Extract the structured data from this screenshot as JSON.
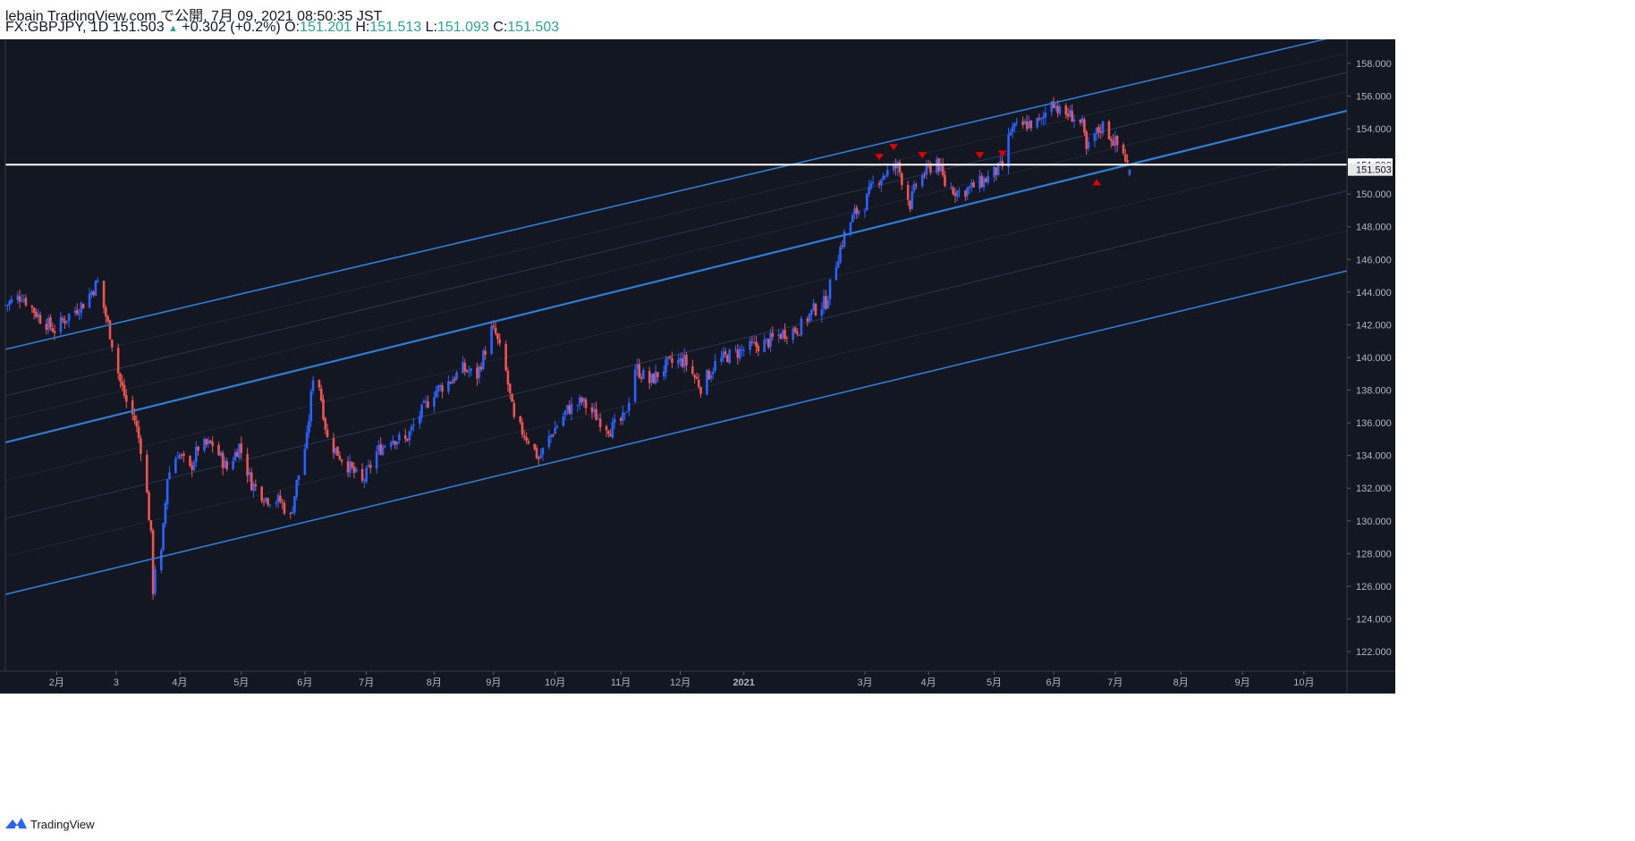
{
  "header": {
    "published_line": "lebain TradingView.com で公開, 7月 09, 2021 08:50:35 JST",
    "symbol": "FX:GBPJPY, 1D",
    "last": "151.503",
    "change": "+0.302 (+0.2%)",
    "o_label": "O:",
    "o_value": "151.201",
    "h_label": "H:",
    "h_value": "151.513",
    "l_label": "L:",
    "l_value": "151.093",
    "c_label": "C:",
    "c_value": "151.503"
  },
  "footer": {
    "brand": "TradingView"
  },
  "colors": {
    "background": "#131722",
    "up": "#2962ff",
    "down": "#ef5350",
    "channel": "#2e7dd7",
    "hline": "#ffffff",
    "marker": "#e00000",
    "text": "#b2b5be"
  },
  "price_labels": {
    "hline": "151.800",
    "last": "151.503"
  },
  "chart_data": {
    "type": "candlestick",
    "title": "FX:GBPJPY, 1D",
    "ylim": [
      120.8,
      159.8
    ],
    "y_ticks": [
      122,
      124,
      126,
      128,
      130,
      132,
      134,
      136,
      138,
      140,
      142,
      144,
      146,
      148,
      150,
      152,
      154,
      156,
      158
    ],
    "y_tick_labels": [
      "122.000",
      "124.000",
      "126.000",
      "128.000",
      "130.000",
      "132.000",
      "134.000",
      "136.000",
      "138.000",
      "140.000",
      "142.000",
      "144.000",
      "146.000",
      "148.000",
      "150.000",
      "152.000",
      "154.000",
      "156.000",
      "158.000"
    ],
    "x_range": [
      "2020-01-07",
      "2021-10-22"
    ],
    "x_ticks": [
      {
        "date": "2020-02-01",
        "label": "2月"
      },
      {
        "date": "2020-03-01",
        "label": "3"
      },
      {
        "date": "2020-04-01",
        "label": "4月"
      },
      {
        "date": "2020-05-01",
        "label": "5月"
      },
      {
        "date": "2020-06-01",
        "label": "6月"
      },
      {
        "date": "2020-07-01",
        "label": "7月"
      },
      {
        "date": "2020-08-03",
        "label": "8月"
      },
      {
        "date": "2020-09-01",
        "label": "9月"
      },
      {
        "date": "2020-10-01",
        "label": "10月"
      },
      {
        "date": "2020-11-02",
        "label": "11月"
      },
      {
        "date": "2020-12-01",
        "label": "12月"
      },
      {
        "date": "2021-01-01",
        "label": "2021"
      },
      {
        "date": "2021-03-01",
        "label": "3月"
      },
      {
        "date": "2021-04-01",
        "label": "4月"
      },
      {
        "date": "2021-05-03",
        "label": "5月"
      },
      {
        "date": "2021-06-01",
        "label": "6月"
      },
      {
        "date": "2021-07-01",
        "label": "7月"
      },
      {
        "date": "2021-08-02",
        "label": "8月"
      },
      {
        "date": "2021-09-01",
        "label": "9月"
      },
      {
        "date": "2021-10-01",
        "label": "10月"
      }
    ],
    "horizontal_line": 151.8,
    "last_price": 151.503,
    "price_path": [
      {
        "date": "2020-01-07",
        "close": 143.2
      },
      {
        "date": "2020-01-15",
        "close": 143.8
      },
      {
        "date": "2020-01-24",
        "close": 142.4
      },
      {
        "date": "2020-01-31",
        "close": 141.7
      },
      {
        "date": "2020-02-07",
        "close": 142.6
      },
      {
        "date": "2020-02-14",
        "close": 143.3
      },
      {
        "date": "2020-02-21",
        "close": 144.6
      },
      {
        "date": "2020-02-27",
        "close": 141.5
      },
      {
        "date": "2020-03-03",
        "close": 138.5
      },
      {
        "date": "2020-03-06",
        "close": 137.3
      },
      {
        "date": "2020-03-10",
        "close": 136.2
      },
      {
        "date": "2020-03-13",
        "close": 134.5
      },
      {
        "date": "2020-03-16",
        "close": 131.6
      },
      {
        "date": "2020-03-18",
        "close": 129.0
      },
      {
        "date": "2020-03-19",
        "close": 125.8
      },
      {
        "date": "2020-03-20",
        "close": 127.2
      },
      {
        "date": "2020-03-23",
        "close": 127.9
      },
      {
        "date": "2020-03-26",
        "close": 132.7
      },
      {
        "date": "2020-03-31",
        "close": 134.2
      },
      {
        "date": "2020-04-06",
        "close": 133.1
      },
      {
        "date": "2020-04-10",
        "close": 134.5
      },
      {
        "date": "2020-04-17",
        "close": 134.7
      },
      {
        "date": "2020-04-24",
        "close": 133.2
      },
      {
        "date": "2020-04-30",
        "close": 134.6
      },
      {
        "date": "2020-05-06",
        "close": 132.3
      },
      {
        "date": "2020-05-13",
        "close": 131.4
      },
      {
        "date": "2020-05-20",
        "close": 131.2
      },
      {
        "date": "2020-05-25",
        "close": 130.2
      },
      {
        "date": "2020-05-28",
        "close": 132.3
      },
      {
        "date": "2020-06-02",
        "close": 135.0
      },
      {
        "date": "2020-06-05",
        "close": 138.9
      },
      {
        "date": "2020-06-08",
        "close": 138.3
      },
      {
        "date": "2020-06-12",
        "close": 135.0
      },
      {
        "date": "2020-06-18",
        "close": 134.0
      },
      {
        "date": "2020-06-24",
        "close": 133.1
      },
      {
        "date": "2020-06-29",
        "close": 132.3
      },
      {
        "date": "2020-07-06",
        "close": 134.2
      },
      {
        "date": "2020-07-13",
        "close": 135.1
      },
      {
        "date": "2020-07-20",
        "close": 134.9
      },
      {
        "date": "2020-07-27",
        "close": 136.5
      },
      {
        "date": "2020-08-03",
        "close": 137.9
      },
      {
        "date": "2020-08-10",
        "close": 138.5
      },
      {
        "date": "2020-08-17",
        "close": 139.3
      },
      {
        "date": "2020-08-24",
        "close": 138.9
      },
      {
        "date": "2020-08-31",
        "close": 141.7
      },
      {
        "date": "2020-09-02",
        "close": 141.4
      },
      {
        "date": "2020-09-07",
        "close": 139.1
      },
      {
        "date": "2020-09-11",
        "close": 136.1
      },
      {
        "date": "2020-09-18",
        "close": 135.0
      },
      {
        "date": "2020-09-23",
        "close": 133.8
      },
      {
        "date": "2020-09-30",
        "close": 135.5
      },
      {
        "date": "2020-10-07",
        "close": 136.8
      },
      {
        "date": "2020-10-14",
        "close": 137.3
      },
      {
        "date": "2020-10-21",
        "close": 136.4
      },
      {
        "date": "2020-10-28",
        "close": 135.6
      },
      {
        "date": "2020-11-04",
        "close": 136.3
      },
      {
        "date": "2020-11-09",
        "close": 139.4
      },
      {
        "date": "2020-11-16",
        "close": 138.5
      },
      {
        "date": "2020-11-25",
        "close": 139.6
      },
      {
        "date": "2020-12-03",
        "close": 139.8
      },
      {
        "date": "2020-12-11",
        "close": 138.2
      },
      {
        "date": "2020-12-18",
        "close": 139.6
      },
      {
        "date": "2020-12-24",
        "close": 140.1
      },
      {
        "date": "2021-01-04",
        "close": 140.6
      },
      {
        "date": "2021-01-12",
        "close": 140.9
      },
      {
        "date": "2021-01-20",
        "close": 141.5
      },
      {
        "date": "2021-01-28",
        "close": 141.8
      },
      {
        "date": "2021-02-04",
        "close": 142.9
      },
      {
        "date": "2021-02-10",
        "close": 143.4
      },
      {
        "date": "2021-02-16",
        "close": 146.3
      },
      {
        "date": "2021-02-19",
        "close": 147.5
      },
      {
        "date": "2021-02-24",
        "close": 148.8
      },
      {
        "date": "2021-03-01",
        "close": 149.4
      },
      {
        "date": "2021-03-05",
        "close": 150.6
      },
      {
        "date": "2021-03-10",
        "close": 151.2
      },
      {
        "date": "2021-03-17",
        "close": 151.7
      },
      {
        "date": "2021-03-23",
        "close": 149.4
      },
      {
        "date": "2021-03-26",
        "close": 150.6
      },
      {
        "date": "2021-03-31",
        "close": 151.4
      },
      {
        "date": "2021-04-05",
        "close": 152.1
      },
      {
        "date": "2021-04-09",
        "close": 150.6
      },
      {
        "date": "2021-04-16",
        "close": 150.1
      },
      {
        "date": "2021-04-22",
        "close": 150.4
      },
      {
        "date": "2021-04-29",
        "close": 150.9
      },
      {
        "date": "2021-05-04",
        "close": 151.4
      },
      {
        "date": "2021-05-07",
        "close": 151.7
      },
      {
        "date": "2021-05-11",
        "close": 153.9
      },
      {
        "date": "2021-05-19",
        "close": 154.3
      },
      {
        "date": "2021-05-26",
        "close": 154.4
      },
      {
        "date": "2021-05-31",
        "close": 155.9
      },
      {
        "date": "2021-06-04",
        "close": 155.0
      },
      {
        "date": "2021-06-10",
        "close": 154.8
      },
      {
        "date": "2021-06-15",
        "close": 154.2
      },
      {
        "date": "2021-06-17",
        "close": 152.6
      },
      {
        "date": "2021-06-21",
        "close": 153.6
      },
      {
        "date": "2021-06-25",
        "close": 154.2
      },
      {
        "date": "2021-06-30",
        "close": 153.3
      },
      {
        "date": "2021-07-05",
        "close": 152.5
      },
      {
        "date": "2021-07-08",
        "close": 151.503
      }
    ],
    "channels": [
      {
        "name": "upper",
        "from": {
          "date": "2020-01-07",
          "price": 140.5
        },
        "to": {
          "date": "2021-10-22",
          "price": 159.8
        }
      },
      {
        "name": "middle",
        "from": {
          "date": "2020-01-07",
          "price": 134.8
        },
        "to": {
          "date": "2021-10-22",
          "price": 155.1
        }
      },
      {
        "name": "lower",
        "from": {
          "date": "2020-01-07",
          "price": 125.5
        },
        "to": {
          "date": "2021-10-22",
          "price": 145.3
        }
      }
    ],
    "markers": [
      {
        "date": "2021-03-08",
        "price": 152.3,
        "dir": "down"
      },
      {
        "date": "2021-03-15",
        "price": 152.9,
        "dir": "down"
      },
      {
        "date": "2021-03-29",
        "price": 152.4,
        "dir": "down"
      },
      {
        "date": "2021-04-26",
        "price": 152.4,
        "dir": "down"
      },
      {
        "date": "2021-05-07",
        "price": 152.5,
        "dir": "down"
      },
      {
        "date": "2021-06-22",
        "price": 150.7,
        "dir": "up"
      }
    ]
  }
}
